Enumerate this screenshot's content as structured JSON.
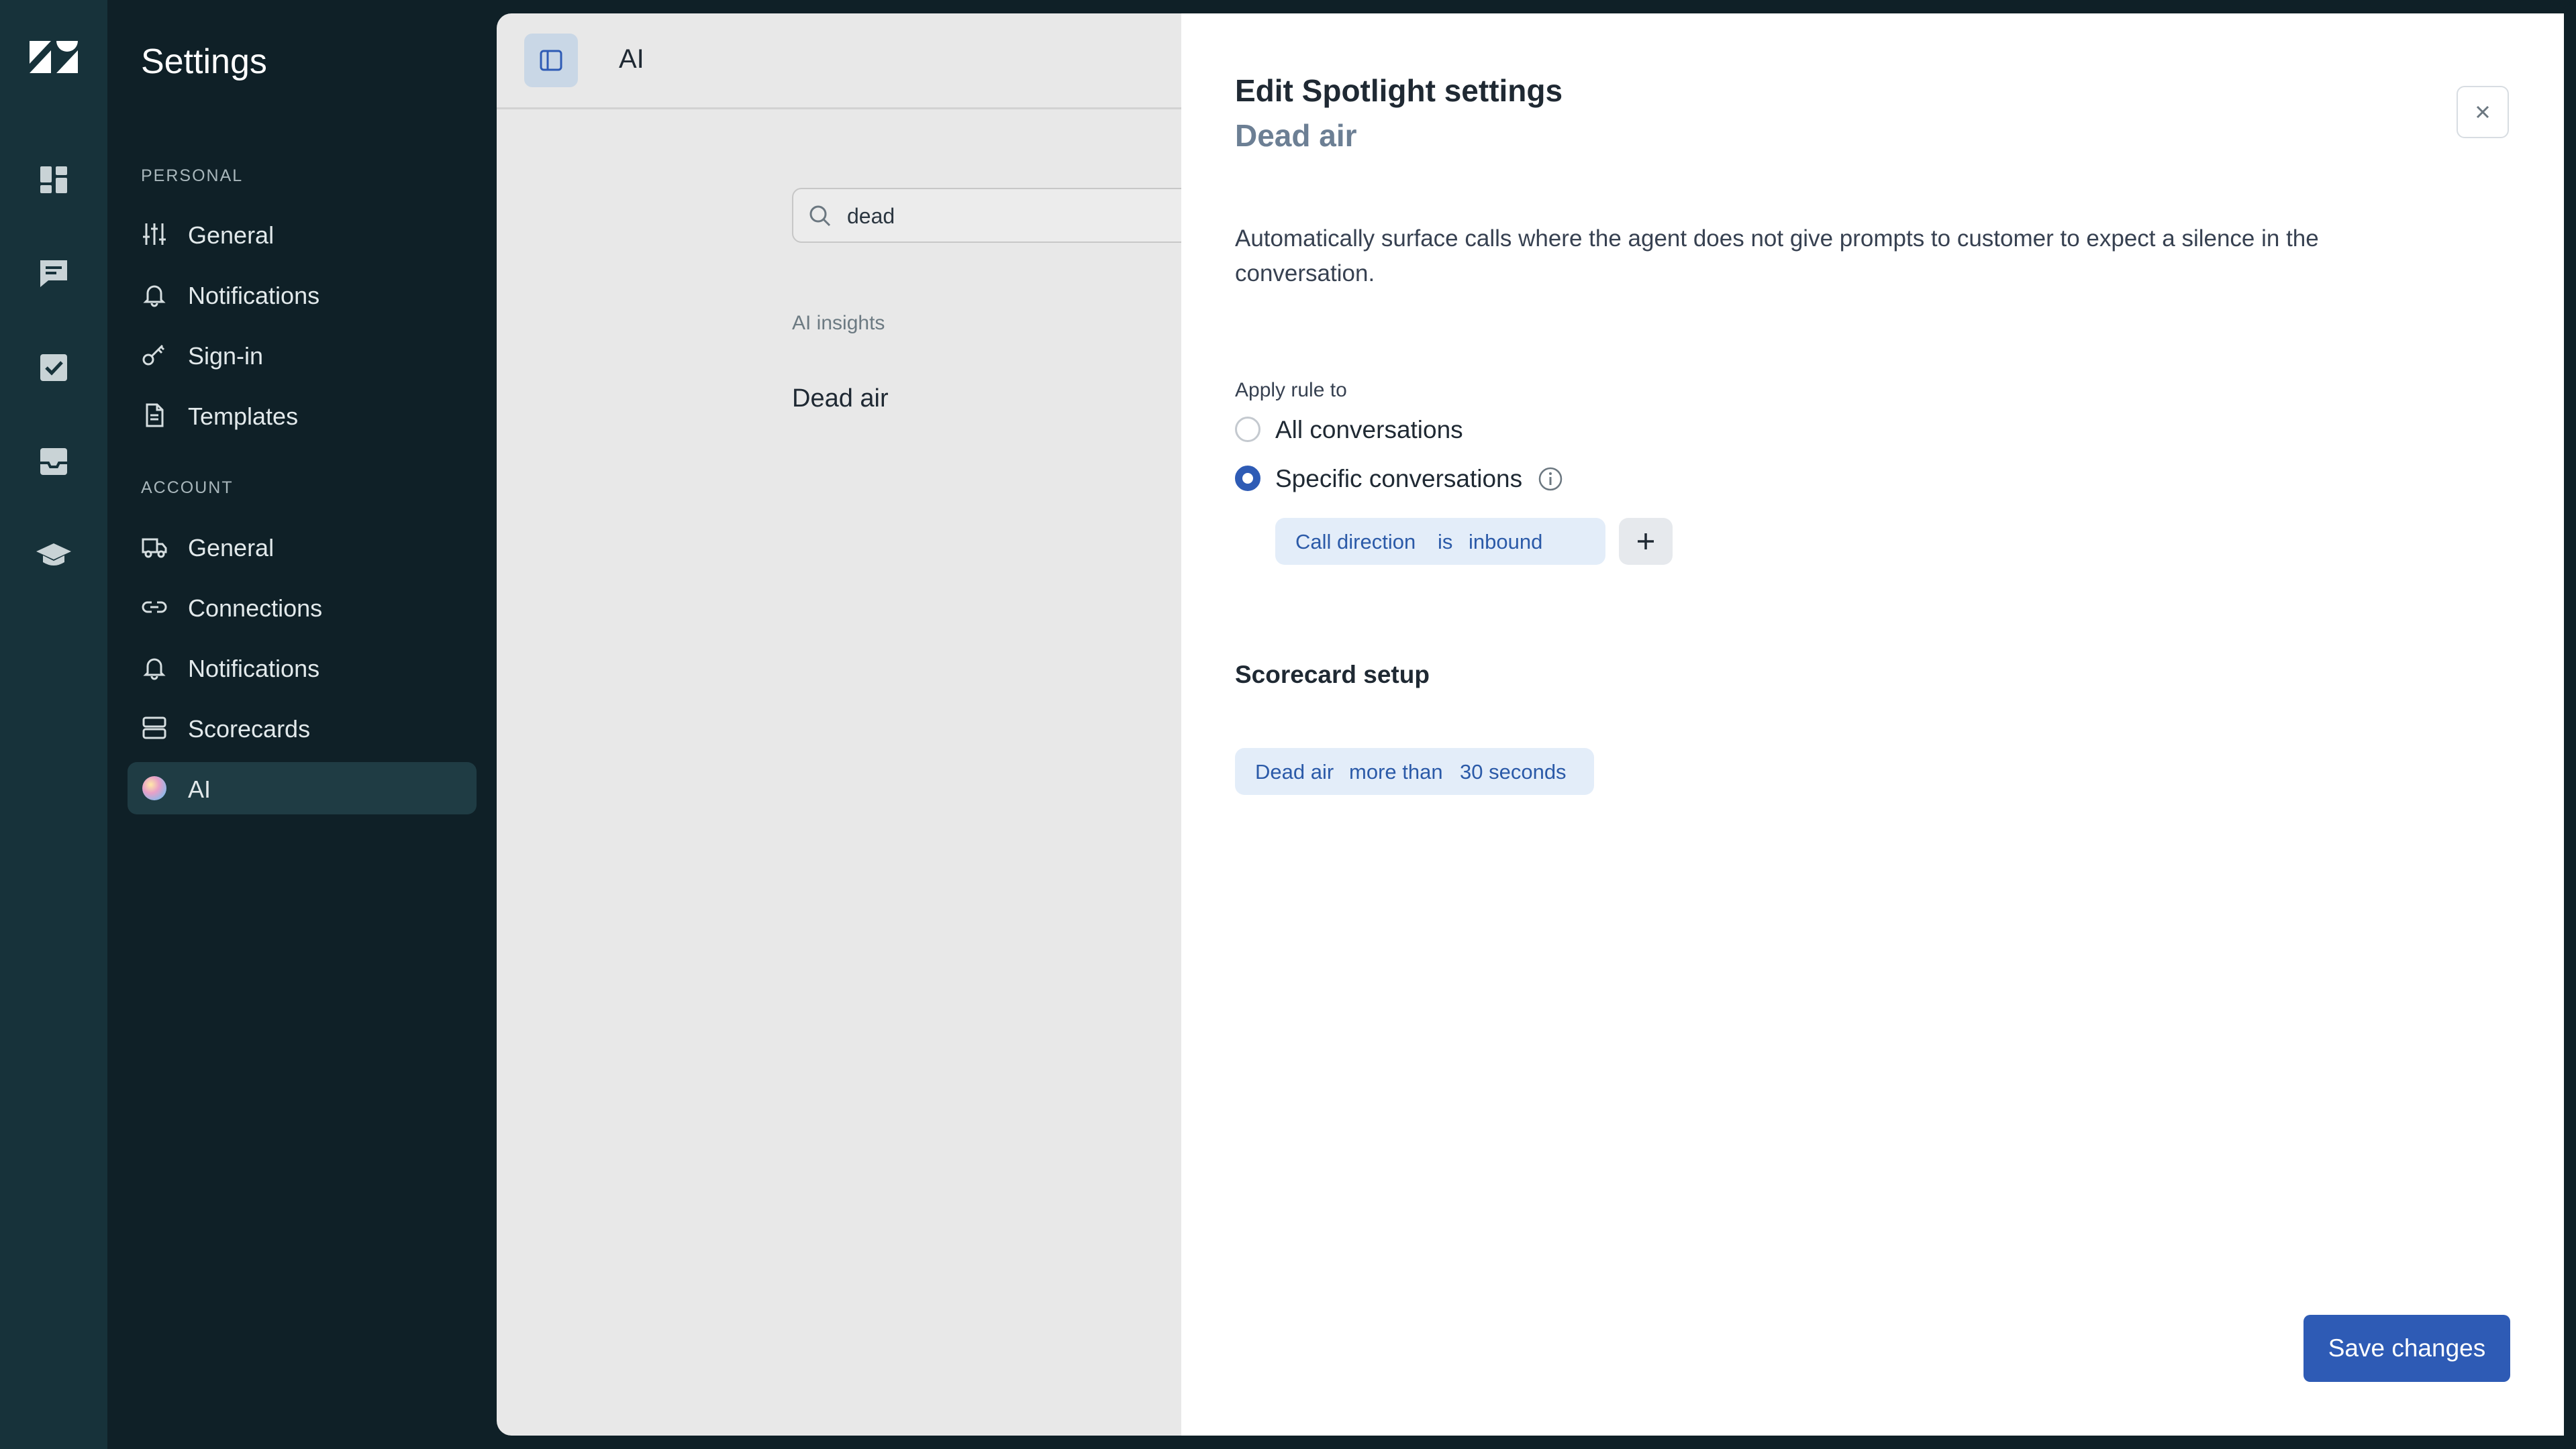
{
  "rail": {
    "icons": [
      "zendesk-logo",
      "dashboard-icon",
      "chat-icon",
      "check-square-icon",
      "inbox-icon",
      "graduation-cap-icon"
    ]
  },
  "sidebar": {
    "title": "Settings",
    "personal_label": "PERSONAL",
    "personal_items": [
      {
        "label": "General",
        "icon": "sliders-icon"
      },
      {
        "label": "Notifications",
        "icon": "bell-icon"
      },
      {
        "label": "Sign-in",
        "icon": "key-icon"
      },
      {
        "label": "Templates",
        "icon": "document-icon"
      }
    ],
    "account_label": "ACCOUNT",
    "account_items": [
      {
        "label": "General",
        "icon": "truck-icon"
      },
      {
        "label": "Connections",
        "icon": "link-icon"
      },
      {
        "label": "Notifications",
        "icon": "bell-icon"
      },
      {
        "label": "Scorecards",
        "icon": "server-icon"
      },
      {
        "label": "AI",
        "icon": "ai-orb-icon",
        "active": true
      }
    ]
  },
  "main": {
    "title": "AI",
    "search_value": "dead",
    "group_label": "AI insights",
    "insight_item": "Dead air"
  },
  "panel": {
    "title": "Edit Spotlight settings",
    "subtitle": "Dead air",
    "description": "Automatically surface calls where the agent does not give prompts to customer to expect a silence in the conversation.",
    "apply_label": "Apply rule to",
    "options": [
      {
        "label": "All conversations",
        "selected": false
      },
      {
        "label": "Specific conversations",
        "selected": true
      }
    ],
    "condition": {
      "field": "Call direction",
      "operator": "is",
      "value": "inbound"
    },
    "scorecard_title": "Scorecard setup",
    "scorecard_rule": {
      "metric": "Dead air",
      "operator": "more than",
      "value": "30 seconds"
    },
    "save_label": "Save changes"
  },
  "colors": {
    "primary": "#2e5bb5",
    "chip_bg": "#e3edf9",
    "sidebar_bg": "#0f2027",
    "rail_bg": "#17323a"
  }
}
